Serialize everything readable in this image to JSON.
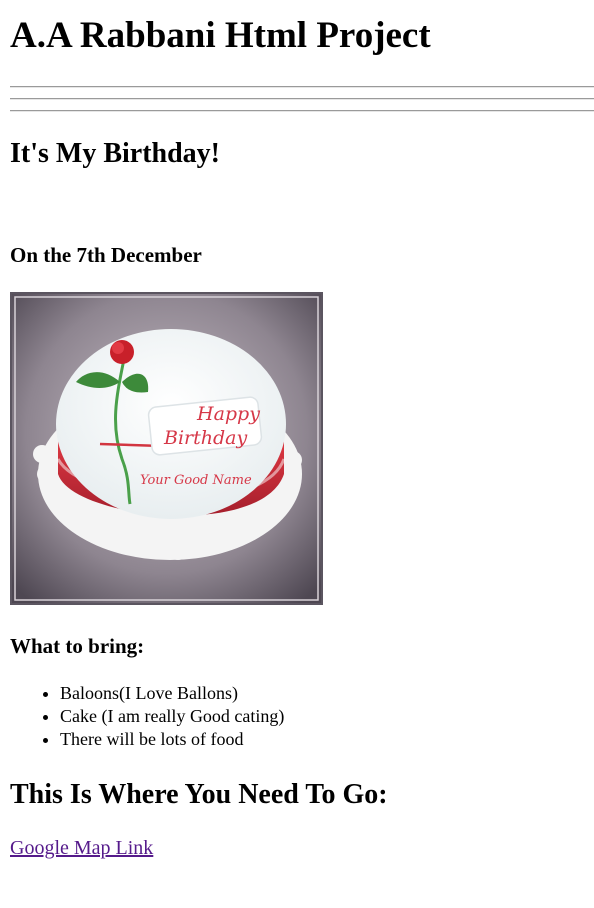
{
  "header": {
    "title": "A.A Rabbani Html Project"
  },
  "birthday": {
    "heading": "It's My Birthday!",
    "date": "On the 7th December"
  },
  "cake_image": {
    "alt": "Birthday cake",
    "tag_line1": "Happy",
    "tag_line2": "Birthday",
    "name_text": "Your Good Name"
  },
  "bring": {
    "heading": "What to bring:",
    "items": [
      "Baloons(I Love Ballons)",
      "Cake (I am really Good cating)",
      "There will be lots of food"
    ]
  },
  "location": {
    "heading": "This Is Where You Need To Go:",
    "link_text": "Google Map Link"
  },
  "colors": {
    "link_visited": "#551a8b",
    "cake_red": "#c8323c",
    "leaf_green": "#3d8a3a"
  }
}
